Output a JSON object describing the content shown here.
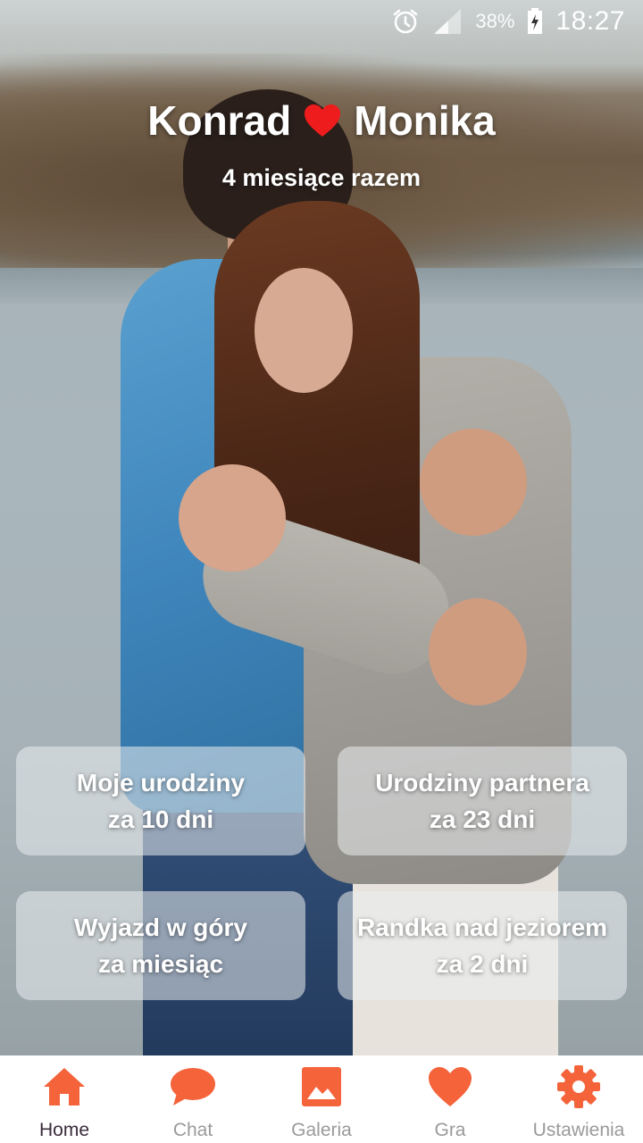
{
  "status_bar": {
    "battery_percent": "38%",
    "time": "18:27"
  },
  "header": {
    "partner_one": "Konrad",
    "partner_two": "Monika",
    "together": "4 miesiące razem"
  },
  "events": [
    {
      "title": "Moje urodziny",
      "when": "za 10 dni"
    },
    {
      "title": "Urodziny partnera",
      "when": "za 23 dni"
    },
    {
      "title": "Wyjazd w góry",
      "when": "za miesiąc"
    },
    {
      "title": "Randka nad jeziorem",
      "when": "za 2 dni"
    }
  ],
  "nav": {
    "items": [
      {
        "label": "Home",
        "icon": "home-icon",
        "active": true
      },
      {
        "label": "Chat",
        "icon": "chat-icon",
        "active": false
      },
      {
        "label": "Galeria",
        "icon": "gallery-icon",
        "active": false
      },
      {
        "label": "Gra",
        "icon": "heart-icon",
        "active": false
      },
      {
        "label": "Ustawienia",
        "icon": "gear-icon",
        "active": false
      }
    ]
  },
  "colors": {
    "accent": "#f4633a",
    "heart": "#ee1c1c",
    "active_label": "#3a2b3b",
    "inactive_label": "#9a9a9a"
  }
}
